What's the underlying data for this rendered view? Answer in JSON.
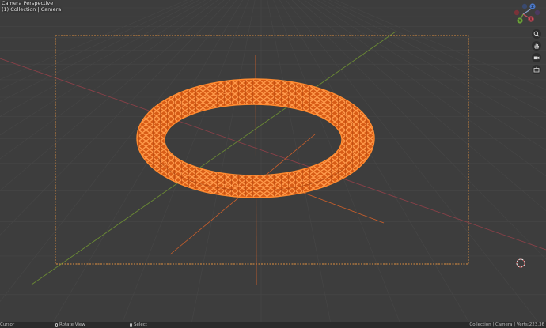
{
  "viewport": {
    "header_title": "Camera Perspective",
    "header_subtitle": "(1) Collection | Camera",
    "gizmo_axes": {
      "x": "X",
      "y": "Y",
      "z": "Z"
    },
    "colors": {
      "background": "#3d3d3d",
      "grid": "#4a4a4a",
      "x_axis": "#9a4a50",
      "y_axis": "#6f8a3a",
      "object": "#e0651a",
      "selection": "#ff8a30",
      "camera_frame": "#e88a30"
    },
    "nav_icons": [
      "zoom-icon",
      "hand-pan-icon",
      "camera-view-icon",
      "perspective-toggle-icon"
    ],
    "cursor_icon": "3d-cursor-icon",
    "object_name": "torus-lattice-mesh"
  },
  "statusbar": {
    "left_label": "Cursor",
    "middle_label": "Rotate View",
    "select_label": "Select",
    "right_text": "Collection | Camera | Verts:223,36"
  }
}
